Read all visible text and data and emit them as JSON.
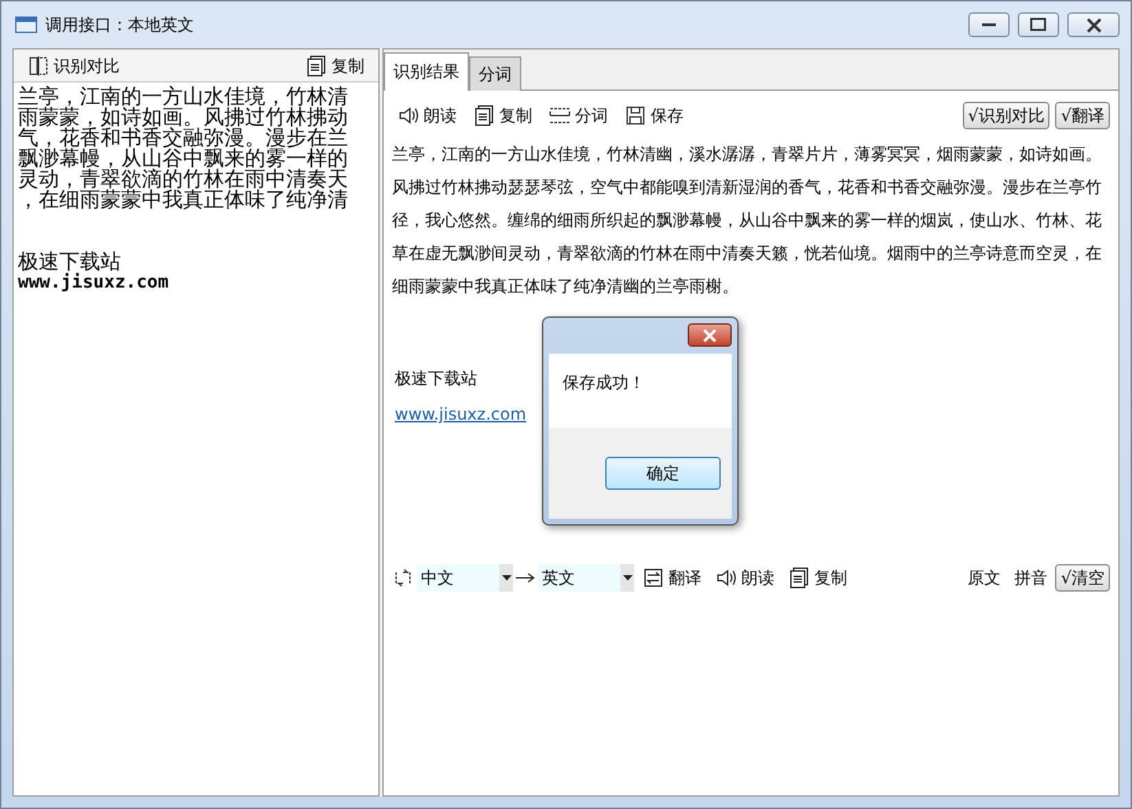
{
  "window": {
    "title": "调用接口：本地英文"
  },
  "left_pane": {
    "toolbar": [
      {
        "label": "识别对比"
      },
      {
        "label": "复制"
      }
    ],
    "source_lines": [
      "兰亭，江南的一方山水佳境，竹林清",
      "雨蒙蒙，如诗如画。风拂过竹林拂动",
      "气，花香和书香交融弥漫。漫步在兰",
      "飘渺幕幔，从山谷中飘来的雾一样的",
      "灵动，青翠欲滴的竹林在雨中清奏天",
      "，在细雨蒙蒙中我真正体味了纯净清"
    ],
    "site_name": "极速下载站",
    "site_url": "www.jisuxz.com"
  },
  "tabs": [
    {
      "label": "识别结果",
      "selected": true
    },
    {
      "label": "分词",
      "selected": false
    }
  ],
  "result_toolbar": [
    {
      "label": "朗读"
    },
    {
      "label": "复制"
    },
    {
      "label": "分词"
    },
    {
      "label": "保存"
    }
  ],
  "toggles": [
    {
      "label": "√识别对比",
      "pressed": true
    },
    {
      "label": "√翻译",
      "pressed": true
    }
  ],
  "result_text": "兰亭，江南的一方山水佳境，竹林清幽，溪水潺潺，青翠片片，薄雾冥冥，烟雨蒙蒙，如诗如画。风拂过竹林拂动瑟瑟琴弦，空气中都能嗅到清新湿润的香气，花香和书香交融弥漫。漫步在兰亭竹径，我心悠然。缠绵的细雨所织起的飘渺幕幔，从山谷中飘来的雾一样的烟岚，使山水、竹林、花草在虚无飘渺间灵动，青翠欲滴的竹林在雨中清奏天籁，恍若仙境。烟雨中的兰亭诗意而空灵，在细雨蒙蒙中我真正体味了纯净清幽的兰亭雨榭。",
  "result_site_name": "极速下载站",
  "result_site_url": "www.jisuxz.com",
  "translate_bar": {
    "source_lang": "中文",
    "target_lang": "英文",
    "actions": [
      {
        "label": "翻译"
      },
      {
        "label": "朗读"
      },
      {
        "label": "复制"
      }
    ],
    "options": [
      {
        "label": "原文",
        "pressed": false
      },
      {
        "label": "拼音",
        "pressed": false
      },
      {
        "label": "√清空",
        "pressed": true
      }
    ]
  },
  "dialog": {
    "message": "保存成功！",
    "ok": "确定"
  }
}
